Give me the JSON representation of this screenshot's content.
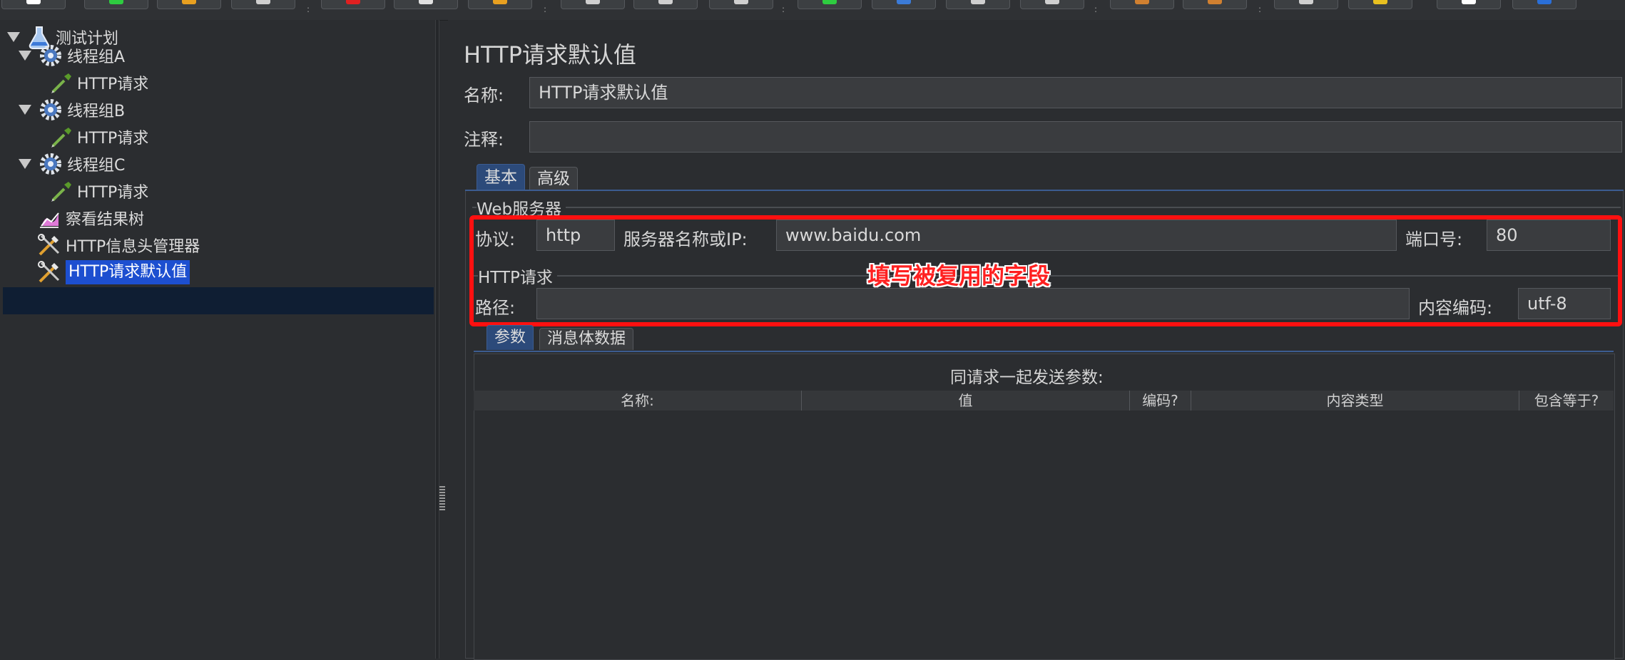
{
  "toolbar": {
    "button_accents": [
      "#ffffff",
      "#2ecc40",
      "#e8a020",
      "#cfcfcf",
      "#e02020",
      "#e0e0e0",
      "#e8a020",
      "#cfcfcf",
      "#cfcfcf",
      "#cfcfcf",
      "#2ecc40",
      "#3b7bd8",
      "#cfcfcf",
      "#cfcfcf",
      "#d08030",
      "#d08030",
      "#cfcfcf",
      "#e8c020",
      "#ffffff",
      "#2a6fd8"
    ],
    "separator": ":"
  },
  "tree": {
    "items": [
      {
        "label": "测试计划",
        "icon": "flask-icon",
        "expanded": true
      },
      {
        "label": "线程组A",
        "icon": "gear-icon",
        "expanded": true
      },
      {
        "label": "HTTP请求",
        "icon": "pipette-icon"
      },
      {
        "label": "线程组B",
        "icon": "gear-icon",
        "expanded": true
      },
      {
        "label": "HTTP请求",
        "icon": "pipette-icon"
      },
      {
        "label": "线程组C",
        "icon": "gear-icon",
        "expanded": true
      },
      {
        "label": "HTTP请求",
        "icon": "pipette-icon"
      },
      {
        "label": "察看结果树",
        "icon": "chart-icon"
      },
      {
        "label": "HTTP信息头管理器",
        "icon": "tools-icon"
      },
      {
        "label": "HTTP请求默认值",
        "icon": "tools-icon",
        "selected": true
      }
    ]
  },
  "panel": {
    "title": "HTTP请求默认值",
    "name_label": "名称:",
    "name_value": "HTTP请求默认值",
    "comment_label": "注释:",
    "comment_value": "",
    "tabs": [
      {
        "label": "基本",
        "active": true
      },
      {
        "label": "高级",
        "active": false
      }
    ],
    "web_server": {
      "group_label": "Web服务器",
      "protocol_label": "协议:",
      "protocol_value": "http",
      "server_label": "服务器名称或IP:",
      "server_value": "www.baidu.com",
      "port_label": "端口号:",
      "port_value": "80"
    },
    "http_request": {
      "group_label": "HTTP请求",
      "path_label": "路径:",
      "path_value": "",
      "encoding_label": "内容编码:",
      "encoding_value": "utf-8"
    },
    "annotation": "填写被复用的字段",
    "annotation_color": "#ff1010",
    "sub_tabs": [
      {
        "label": "参数",
        "active": true
      },
      {
        "label": "消息体数据",
        "active": false
      }
    ],
    "params_caption": "同请求一起发送参数:",
    "columns": [
      "名称:",
      "值",
      "编码?",
      "内容类型",
      "包含等于?"
    ]
  }
}
